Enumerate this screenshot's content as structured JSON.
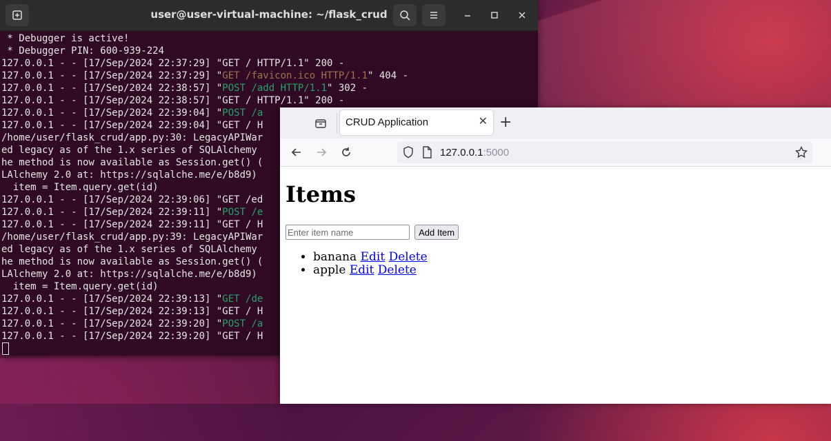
{
  "terminal": {
    "title": "user@user-virtual-machine: ~/flask_crud",
    "lines": [
      [
        {
          "t": " * Debugger is active!"
        }
      ],
      [
        {
          "t": " * Debugger PIN: 600-939-224"
        }
      ],
      [
        {
          "t": "127.0.0.1 - - [17/Sep/2024 22:37:29] \"GET / HTTP/1.1\" 200 -"
        }
      ],
      [
        {
          "t": "127.0.0.1 - - [17/Sep/2024 22:37:29] \""
        },
        {
          "t": "GET /favicon.ico HTTP/1.1",
          "c": "o"
        },
        {
          "t": "\" 404 -"
        }
      ],
      [
        {
          "t": "127.0.0.1 - - [17/Sep/2024 22:38:57] \""
        },
        {
          "t": "POST /add HTTP/1.1",
          "c": "g"
        },
        {
          "t": "\" 302 -"
        }
      ],
      [
        {
          "t": "127.0.0.1 - - [17/Sep/2024 22:38:57] \"GET / HTTP/1.1\" 200 -"
        }
      ],
      [
        {
          "t": "127.0.0.1 - - [17/Sep/2024 22:39:04] \""
        },
        {
          "t": "POST /a",
          "c": "g"
        }
      ],
      [
        {
          "t": "127.0.0.1 - - [17/Sep/2024 22:39:04] \"GET / H"
        }
      ],
      [
        {
          "t": "/home/user/flask_crud/app.py:30: LegacyAPIWar"
        }
      ],
      [
        {
          "t": "ed legacy as of the 1.x series of SQLAlchemy"
        }
      ],
      [
        {
          "t": "he method is now available as Session.get() ("
        }
      ],
      [
        {
          "t": "LAlchemy 2.0 at: https://sqlalche.me/e/b8d9)"
        }
      ],
      [
        {
          "t": "  item = Item.query.get(id)"
        }
      ],
      [
        {
          "t": "127.0.0.1 - - [17/Sep/2024 22:39:06] \"GET /ed"
        }
      ],
      [
        {
          "t": "127.0.0.1 - - [17/Sep/2024 22:39:11] \""
        },
        {
          "t": "POST /e",
          "c": "g"
        }
      ],
      [
        {
          "t": "127.0.0.1 - - [17/Sep/2024 22:39:11] \"GET / H"
        }
      ],
      [
        {
          "t": "/home/user/flask_crud/app.py:39: LegacyAPIWar"
        }
      ],
      [
        {
          "t": "ed legacy as of the 1.x series of SQLAlchemy"
        }
      ],
      [
        {
          "t": "he method is now available as Session.get() ("
        }
      ],
      [
        {
          "t": "LAlchemy 2.0 at: https://sqlalche.me/e/b8d9)"
        }
      ],
      [
        {
          "t": "  item = Item.query.get(id)"
        }
      ],
      [
        {
          "t": "127.0.0.1 - - [17/Sep/2024 22:39:13] \""
        },
        {
          "t": "GET /de",
          "c": "g"
        }
      ],
      [
        {
          "t": "127.0.0.1 - - [17/Sep/2024 22:39:13] \"GET / H"
        }
      ],
      [
        {
          "t": "127.0.0.1 - - [17/Sep/2024 22:39:20] \""
        },
        {
          "t": "POST /a",
          "c": "g"
        }
      ],
      [
        {
          "t": "127.0.0.1 - - [17/Sep/2024 22:39:20] \"GET / H"
        }
      ]
    ],
    "colors": {
      "background": "#300a24",
      "green": "#26a269",
      "orange": "#a2734c"
    }
  },
  "browser": {
    "tab_title": "CRUD Application",
    "url_host": "127.0.0.1",
    "url_port": ":5000",
    "page": {
      "heading": "Items",
      "input_placeholder": "Enter item name",
      "add_button": "Add Item",
      "items": [
        {
          "name": "banana",
          "edit": "Edit",
          "delete": "Delete"
        },
        {
          "name": "apple",
          "edit": "Edit",
          "delete": "Delete"
        }
      ]
    }
  }
}
